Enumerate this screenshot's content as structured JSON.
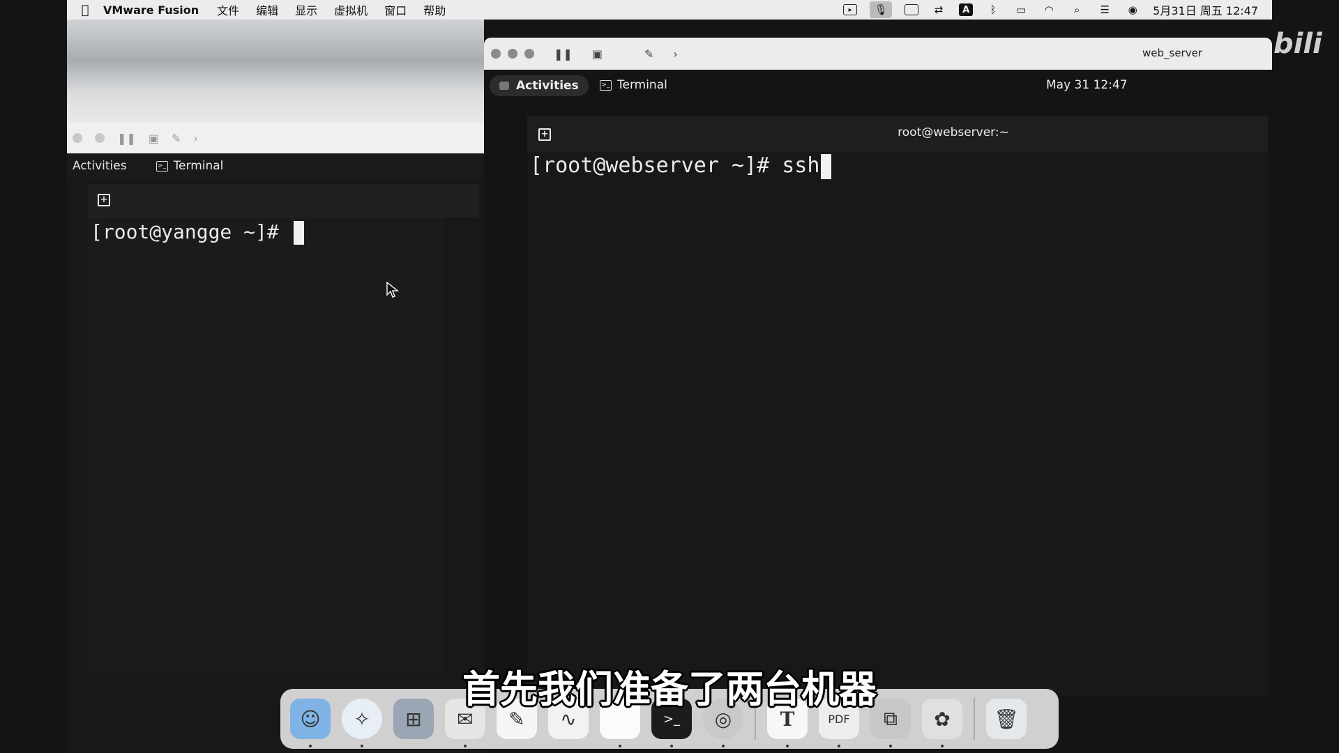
{
  "menubar": {
    "app": "VMware Fusion",
    "menus": [
      "文件",
      "编辑",
      "显示",
      "虚拟机",
      "窗口",
      "帮助"
    ],
    "status_icons": [
      "camera-icon",
      "microphone-icon",
      "screen-share-icon",
      "sync-icon",
      "input-method-icon",
      "bluetooth-icon",
      "battery-icon",
      "wifi-icon",
      "search-icon",
      "control-center-icon",
      "siri-icon"
    ],
    "input_method_label": "A",
    "clock": "5月31日 周五 12:47"
  },
  "left_vm": {
    "activities": "Activities",
    "app": "Terminal",
    "prompt": "[root@yangge ~]# "
  },
  "right_vm": {
    "vm_name": "web_server",
    "activities": "Activities",
    "app": "Terminal",
    "clock": "May 31  12:47",
    "terminal_title": "root@webserver:~",
    "prompt": "[root@webserver ~]# ssh"
  },
  "watermark": "bili",
  "subtitle": "首先我们准备了两台机器",
  "dock": {
    "apps": [
      "finder-icon",
      "safari-icon",
      "launchpad-icon",
      "mail-icon",
      "textedit-icon",
      "freeform-icon",
      "notes-icon",
      "terminal-icon",
      "chrome-icon",
      "typora-icon",
      "pdf-icon",
      "vmware-icon",
      "script-icon",
      "trash-icon"
    ]
  }
}
